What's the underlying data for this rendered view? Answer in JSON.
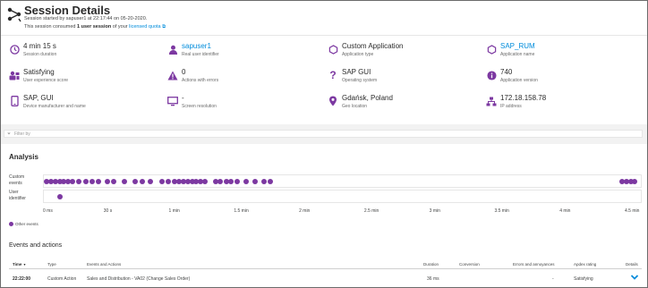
{
  "header": {
    "title": "Session Details",
    "started_line": "Session started by sapuser1 at 22:17:44 on 05-20-2020.",
    "consumed_prefix": "This session consumed",
    "consumed_bold": "1 user session",
    "consumed_mid": "of your",
    "consumed_link": "licensed quota"
  },
  "info": [
    {
      "value": "4 min 15 s",
      "label": "Session duration",
      "icon": "clock-icon"
    },
    {
      "value": "sapuser1",
      "label": "Real user identifier",
      "icon": "user-icon",
      "link": true
    },
    {
      "value": "Custom Application",
      "label": "Application type",
      "icon": "hexagon-icon"
    },
    {
      "value": "SAP_RUM",
      "label": "Application name",
      "icon": "hexagon-icon",
      "link": true
    },
    {
      "value": "Satisfying",
      "label": "User experience score",
      "icon": "experience-score-icon"
    },
    {
      "value": "0",
      "label": "Actions with errors",
      "icon": "warning-icon"
    },
    {
      "value": "SAP GUI",
      "label": "Operating system",
      "icon": "question-icon"
    },
    {
      "value": "740",
      "label": "Application version",
      "icon": "info-icon"
    },
    {
      "value": "SAP, GUI",
      "label": "Device manufacturer and name",
      "icon": "mobile-device-icon"
    },
    {
      "value": "-",
      "label": "Screen resolution",
      "icon": "monitor-icon"
    },
    {
      "value": "Gdańsk, Poland",
      "label": "Geo location",
      "icon": "location-pin-icon"
    },
    {
      "value": "172.18.158.78",
      "label": "IP address",
      "icon": "network-icon"
    }
  ],
  "filter": {
    "placeholder": "Filter by"
  },
  "analysis": {
    "title": "Analysis",
    "row1_label_a": "Custom",
    "row1_label_b": "events",
    "row2_label_a": "User",
    "row2_label_b": "identifier",
    "ticks": [
      "0 ms",
      "30 s",
      "1 min",
      "1.5 min",
      "2 min",
      "2.5 min",
      "3 min",
      "3.5 min",
      "4 min",
      "4.5 min"
    ],
    "legend": "Other events",
    "custom_events_seconds": [
      0,
      2,
      4,
      6,
      8,
      10,
      12,
      15,
      18,
      21,
      24,
      28,
      31,
      36,
      41,
      44,
      48,
      53,
      56,
      59,
      61,
      63,
      65,
      67,
      69,
      71,
      73,
      78,
      80,
      83,
      85,
      88,
      92,
      96,
      100,
      103,
      265,
      267,
      269,
      271
    ],
    "user_identifier_seconds": [
      6
    ],
    "accent_color": "#7c38a1"
  },
  "events": {
    "title": "Events and actions",
    "columns": [
      "Time",
      "Type",
      "Events and Actions",
      "Duration",
      "Conversion",
      "Errors and annoyances",
      "Apdex rating",
      "Details"
    ],
    "sort_indicator": "▼",
    "rows": [
      {
        "time": "22:22:00",
        "type": "Custom Action",
        "name": "Sales and Distribution - VA02 (Change Sales Order)",
        "duration": "36 ms",
        "conversion": "",
        "errors": "-",
        "apdex": "Satisfying"
      }
    ]
  }
}
